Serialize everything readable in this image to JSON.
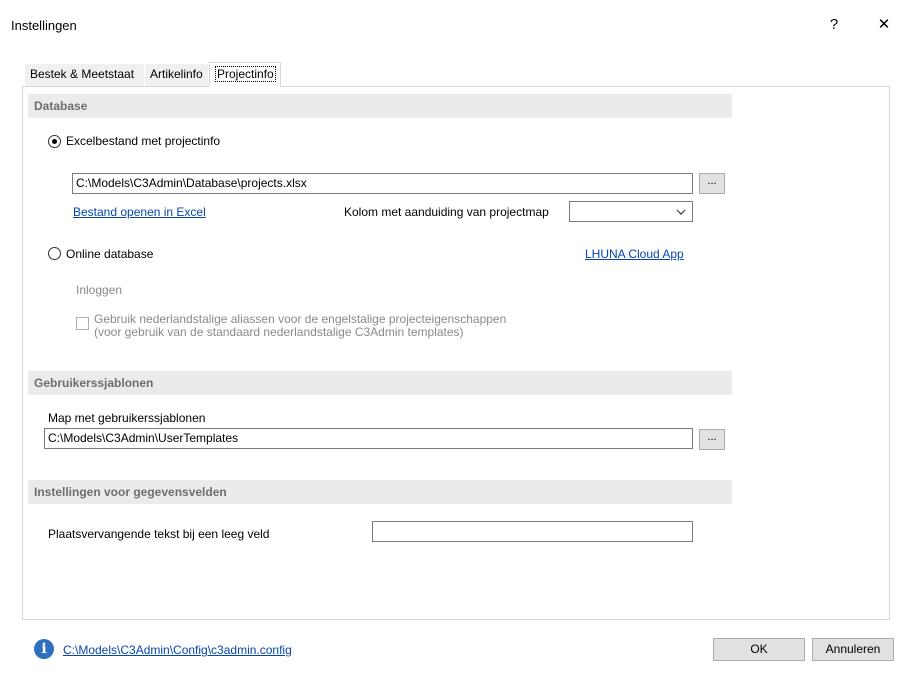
{
  "window": {
    "title": "Instellingen",
    "help_glyph": "?",
    "close_glyph": "✕"
  },
  "tabs": [
    {
      "label": "Bestek & Meetstaat",
      "active": false
    },
    {
      "label": "Artikelinfo",
      "active": false
    },
    {
      "label": "Projectinfo",
      "active": true
    }
  ],
  "database": {
    "section_title": "Database",
    "excel_option_label": "Excelbestand met projectinfo",
    "excel_option_selected": true,
    "excel_path": "C:\\Models\\C3Admin\\Database\\projects.xlsx",
    "browse_label": "...",
    "open_in_excel_link": "Bestand openen in Excel",
    "column_label": "Kolom met aanduiding van projectmap",
    "column_value": "",
    "online_option_label": "Online database",
    "online_option_selected": false,
    "cloud_app_link": "LHUNA Cloud App",
    "login_label": "Inloggen",
    "alias_checkbox_line1": "Gebruik nederlandstalige aliassen voor de engelstalige projecteigenschappen",
    "alias_checkbox_line2": "(voor gebruik van de standaard nederlandstalige C3Admin templates)",
    "alias_checkbox_checked": false
  },
  "user_templates": {
    "section_title": "Gebruikerssjablonen",
    "folder_label": "Map met gebruikerssjablonen",
    "folder_path": "C:\\Models\\C3Admin\\UserTemplates",
    "browse_label": "..."
  },
  "data_fields": {
    "section_title": "Instellingen voor gegevensvelden",
    "placeholder_label": "Plaatsvervangende tekst bij een leeg veld",
    "placeholder_value": ""
  },
  "footer": {
    "config_link": "C:\\Models\\C3Admin\\Config\\c3admin.config",
    "info_glyph": "i",
    "ok_label": "OK",
    "cancel_label": "Annuleren"
  }
}
